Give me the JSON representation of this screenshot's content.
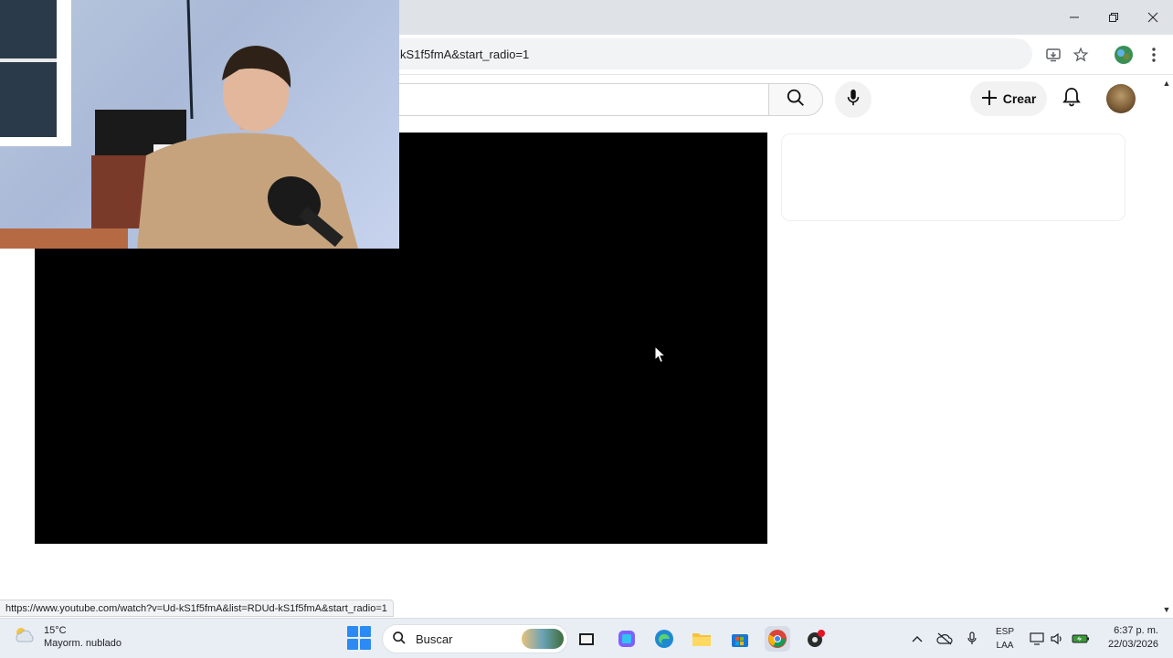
{
  "browser": {
    "address_text": "kS1f5fmA&start_radio=1",
    "status_url": "https://www.youtube.com/watch?v=Ud-kS1f5fmA&list=RDUd-kS1f5fmA&start_radio=1",
    "window_controls": [
      "minimize-icon",
      "restore-icon",
      "close-icon"
    ],
    "toolbar_icons": [
      "install-app-icon",
      "bookmark-star-icon",
      "profile-icon",
      "more-menu-icon"
    ]
  },
  "youtube": {
    "create_label": "Crear",
    "icons": [
      "search-icon",
      "mic-icon",
      "plus-icon",
      "bell-icon"
    ]
  },
  "taskbar": {
    "weather_temp": "15°C",
    "weather_desc": "Mayorm. nublado",
    "search_placeholder": "Buscar",
    "lang_line1": "ESP",
    "lang_line2": "LAA",
    "time": "6:37 p. m.",
    "date": "22/03/2026",
    "accent_color": "#2b8af4"
  }
}
